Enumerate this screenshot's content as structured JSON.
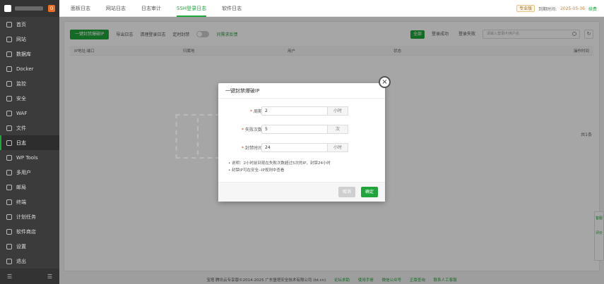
{
  "sidebar": {
    "badge": "0",
    "items": [
      {
        "label": "首页",
        "icon": "home-icon"
      },
      {
        "label": "网站",
        "icon": "globe-icon"
      },
      {
        "label": "数据库",
        "icon": "database-icon"
      },
      {
        "label": "Docker",
        "icon": "docker-icon"
      },
      {
        "label": "监控",
        "icon": "monitor-icon"
      },
      {
        "label": "安全",
        "icon": "shield-icon"
      },
      {
        "label": "WAF",
        "icon": "firewall-icon"
      },
      {
        "label": "文件",
        "icon": "folder-icon"
      },
      {
        "label": "日志",
        "icon": "log-icon"
      },
      {
        "label": "WP Tools",
        "icon": "wordpress-icon"
      },
      {
        "label": "多用户",
        "icon": "users-icon"
      },
      {
        "label": "邮局",
        "icon": "mail-icon"
      },
      {
        "label": "终端",
        "icon": "terminal-icon"
      },
      {
        "label": "计划任务",
        "icon": "clock-icon"
      },
      {
        "label": "软件商店",
        "icon": "store-icon"
      },
      {
        "label": "设置",
        "icon": "gear-icon"
      },
      {
        "label": "退出",
        "icon": "logout-icon"
      }
    ],
    "active_index": 8,
    "bottom_left": "☰",
    "bottom_right": "☰"
  },
  "tabs": [
    "面板日志",
    "网站日志",
    "日志审计",
    "SSH登录日志",
    "软件日志"
  ],
  "active_tab": 3,
  "topright": {
    "vip": "专业版",
    "expire_label": "到期时间:",
    "expire_date": "2025-05-36",
    "renew": "续费"
  },
  "toolbar": {
    "ban_button": "一键封禁爆破IP",
    "export": "导出日志",
    "clear": "清理登录日志",
    "schedule": "定时封禁",
    "feedback": "问需求反馈",
    "filters": [
      "全部",
      "登录成功",
      "登录失败"
    ],
    "search_placeholder": "请输入登录IP/用户名",
    "refresh": "↻"
  },
  "table": {
    "headers": [
      "IP地址:端口",
      "归属地",
      "用户",
      "状态",
      "操作时间"
    ]
  },
  "pager": "共1条",
  "modal": {
    "title": "一键封禁爆破IP",
    "close": "×",
    "fields": [
      {
        "label": "周期",
        "value": "2",
        "unit": "小时"
      },
      {
        "label": "失败次数",
        "value": "5",
        "unit": "次"
      },
      {
        "label": "封禁时间",
        "value": "24",
        "unit": "小时"
      }
    ],
    "notes": [
      "说明：2小时前到现在失败次数超过5次的IP，封禁24小时",
      "封禁IP可在安全--IP规则中查看"
    ],
    "cancel": "取消",
    "confirm": "确定"
  },
  "footer": {
    "text": "宝塔 腾讯云专享版©2014-2025 广东堡塔安全技术有限公司 (bt.cn)",
    "links": [
      "论坛求助",
      "使用手册",
      "微信公众号",
      "正版查询",
      "联系人工客服"
    ]
  },
  "float": [
    "客服",
    "评价"
  ],
  "colors": {
    "accent": "#20a53a",
    "sidebar": "#3b3b3b",
    "danger": "#e53935"
  }
}
